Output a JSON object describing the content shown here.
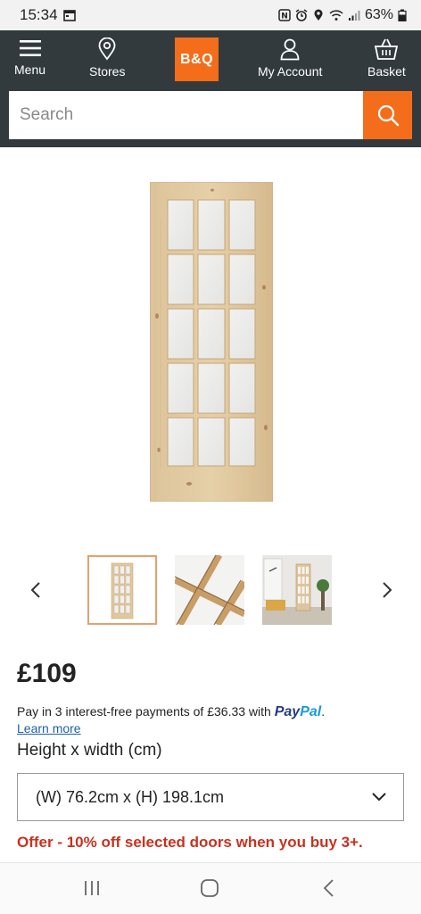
{
  "status_bar": {
    "time": "15:34",
    "battery": "63%",
    "icons": [
      "calendar-icon",
      "nfc-icon",
      "alarm-icon",
      "location-icon",
      "wifi-icon",
      "signal-icon",
      "battery-icon"
    ]
  },
  "header": {
    "logo": "B&Q",
    "nav": {
      "menu": "Menu",
      "stores": "Stores",
      "account": "My Account",
      "basket": "Basket"
    },
    "search": {
      "placeholder": "Search"
    }
  },
  "colors": {
    "header_bg": "#323a3e",
    "brand_orange": "#f46d1b",
    "offer_red": "#c8321f",
    "link_blue": "#1f5fa8"
  },
  "product": {
    "price": "£109",
    "paypal_text": "Pay in 3 interest-free payments of £36.33 with",
    "paypal_brand_pay": "Pay",
    "paypal_brand_pal": "Pal",
    "paypal_period": ".",
    "learn_more": "Learn more",
    "option_label": "Height x width (cm)",
    "selected_size": "(W) 76.2cm x (H) 198.1cm",
    "offer": "Offer - 10% off selected doors when you buy 3+."
  },
  "gallery": {
    "thumbnails": [
      "door-front-thumbnail",
      "door-detail-thumbnail",
      "door-room-thumbnail"
    ],
    "selected_index": 0
  }
}
